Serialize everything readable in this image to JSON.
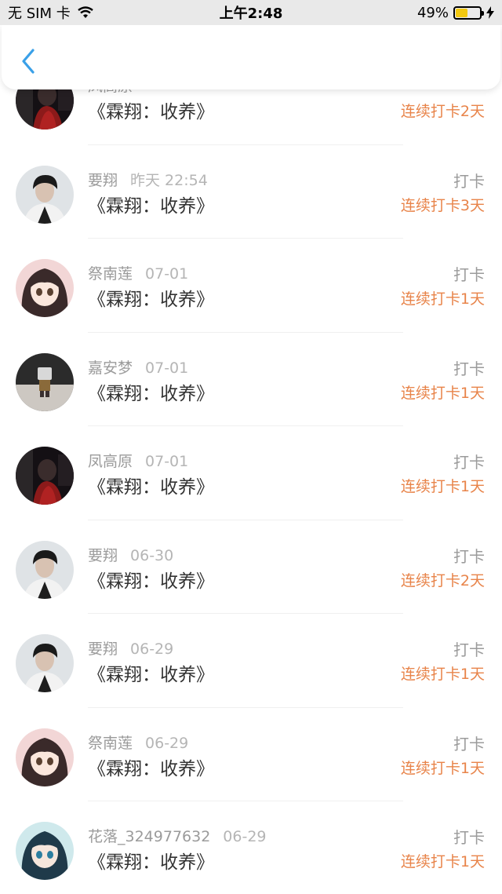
{
  "status_bar": {
    "carrier": "无 SIM 卡",
    "time": "上午2:48",
    "battery_percent": "49%",
    "battery_level": 0.49,
    "icons": [
      "wifi-icon",
      "battery-icon",
      "charging-icon"
    ]
  },
  "nav": {
    "back_icon": "chevron-left-icon"
  },
  "colors": {
    "accent_blue": "#3aa0e8",
    "streak_orange": "#e8844a"
  },
  "rows": [
    {
      "name": "凤高原",
      "date": "",
      "title": "《霖翔：收养》",
      "action": "",
      "streak": "连续打卡2天",
      "avatar": "dark-girl"
    },
    {
      "name": "要翔",
      "date": "昨天 22:54",
      "title": "《霖翔：收养》",
      "action": "打卡",
      "streak": "连续打卡3天",
      "avatar": "boy"
    },
    {
      "name": "祭南莲",
      "date": "07-01",
      "title": "《霖翔：收养》",
      "action": "打卡",
      "streak": "连续打卡1天",
      "avatar": "anime"
    },
    {
      "name": "嘉安梦",
      "date": "07-01",
      "title": "《霖翔：收养》",
      "action": "打卡",
      "streak": "连续打卡1天",
      "avatar": "figure"
    },
    {
      "name": "凤高原",
      "date": "07-01",
      "title": "《霖翔：收养》",
      "action": "打卡",
      "streak": "连续打卡1天",
      "avatar": "dark-girl"
    },
    {
      "name": "要翔",
      "date": "06-30",
      "title": "《霖翔：收养》",
      "action": "打卡",
      "streak": "连续打卡2天",
      "avatar": "boy"
    },
    {
      "name": "要翔",
      "date": "06-29",
      "title": "《霖翔：收养》",
      "action": "打卡",
      "streak": "连续打卡1天",
      "avatar": "boy"
    },
    {
      "name": "祭南莲",
      "date": "06-29",
      "title": "《霖翔：收养》",
      "action": "打卡",
      "streak": "连续打卡1天",
      "avatar": "anime"
    },
    {
      "name": "花落_324977632",
      "date": "06-29",
      "title": "《霖翔：收养》",
      "action": "打卡",
      "streak": "连续打卡1天",
      "avatar": "teal-girl"
    }
  ]
}
